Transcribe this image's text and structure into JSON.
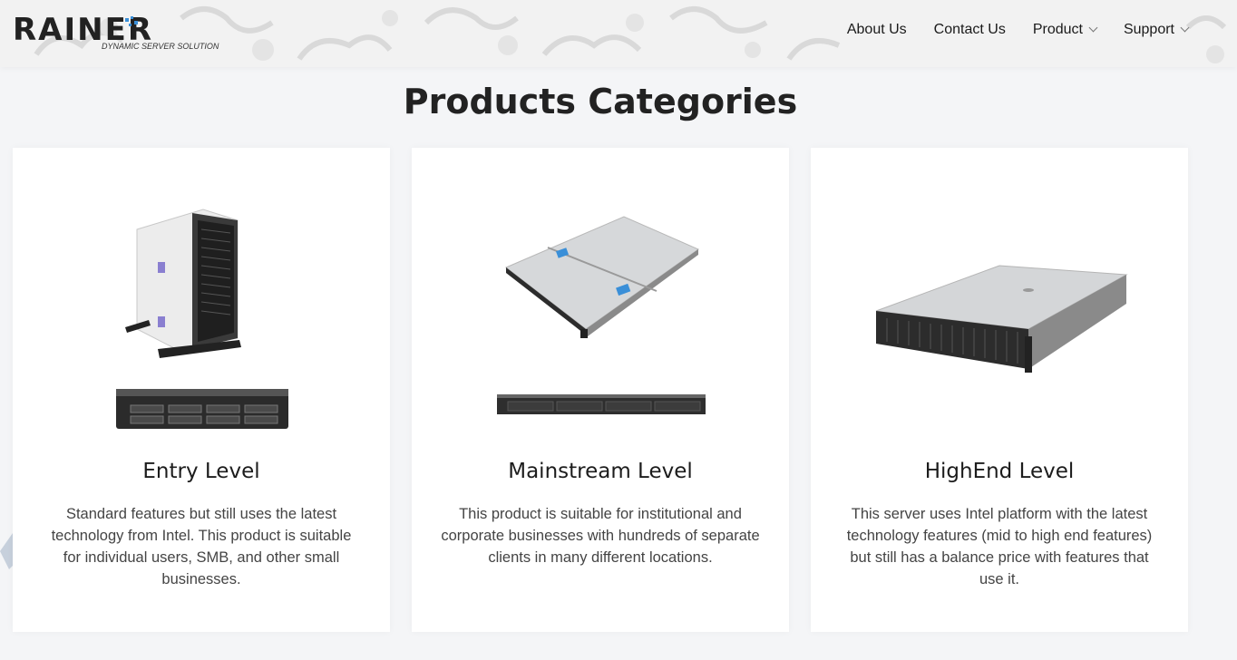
{
  "header": {
    "brand": "RAINER",
    "tagline": "DYNAMIC SERVER SOLUTION",
    "nav": [
      {
        "label": "About Us",
        "has_dropdown": false
      },
      {
        "label": "Contact Us",
        "has_dropdown": false
      },
      {
        "label": "Product",
        "has_dropdown": true
      },
      {
        "label": "Support",
        "has_dropdown": true
      }
    ]
  },
  "main": {
    "title": "Products Categories",
    "cards": [
      {
        "title": "Entry Level",
        "description": "Standard features but still uses the latest technology from Intel. This product is suitable for individual users, SMB, and other small businesses.",
        "image": "tower-and-rack-server-image"
      },
      {
        "title": "Mainstream Level",
        "description": "This product is suitable for institutional and corporate businesses with hundreds of separate clients in many different locations.",
        "image": "1u-rack-server-image"
      },
      {
        "title": "HighEnd Level",
        "description": "This server uses Intel platform with the latest technology features (mid to high end features) but still has a balance price with features that use it.",
        "image": "2u-rack-server-image"
      }
    ]
  },
  "colors": {
    "background": "#f4f5f7",
    "card": "#ffffff",
    "brand_accent": "#3a8fd8"
  }
}
